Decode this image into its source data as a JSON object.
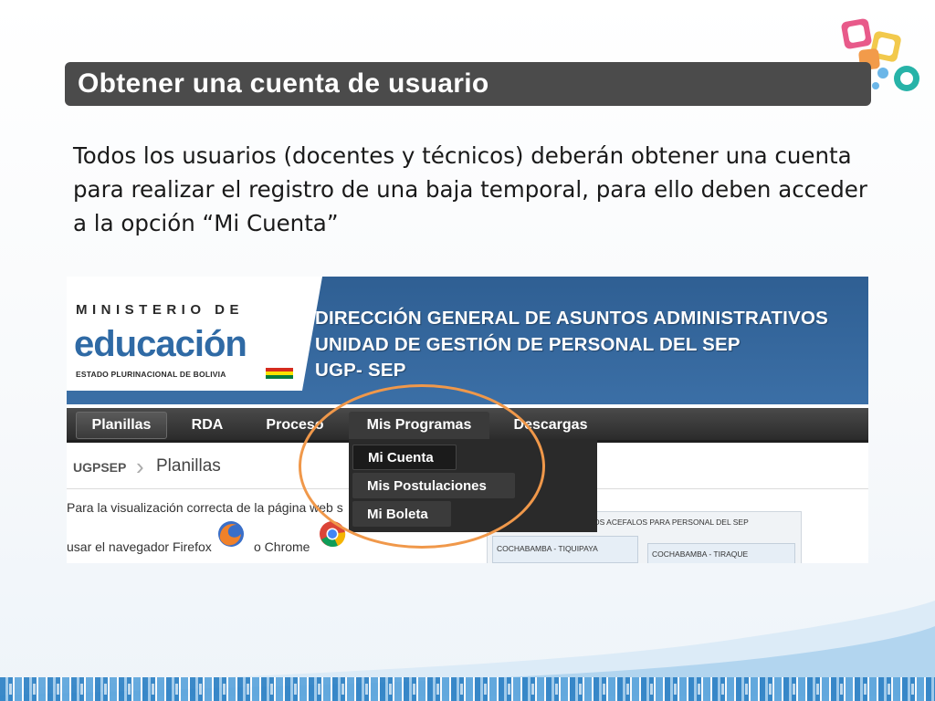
{
  "slide": {
    "title": "Obtener una cuenta de usuario",
    "paragraph": "Todos los usuarios (docentes y técnicos) deberán obtener una cuenta para realizar el registro de una baja temporal, para ello deben acceder a la opción “Mi Cuenta”"
  },
  "web": {
    "ministry": {
      "line1": "MINISTERIO DE",
      "line2": "educación",
      "line3": "ESTADO PLURINACIONAL DE BOLIVIA"
    },
    "header": {
      "line1": "DIRECCIÓN GENERAL DE ASUNTOS ADMINISTRATIVOS",
      "line2": "UNIDAD DE GESTIÓN DE PERSONAL DEL SEP",
      "line3": "UGP- SEP"
    },
    "nav": [
      {
        "label": "Planillas"
      },
      {
        "label": "RDA"
      },
      {
        "label": "Proceso"
      },
      {
        "label": "Mis Programas"
      },
      {
        "label": "Descargas"
      }
    ],
    "dropdown": [
      {
        "label": "Mi Cuenta"
      },
      {
        "label": "Mis Postulaciones"
      },
      {
        "label": "Mi Boleta"
      }
    ],
    "breadcrumb": {
      "home": "UGPSEP",
      "current": "Planillas"
    },
    "notice": {
      "line1": "Para la visualización correcta de la página web s",
      "line2a": "usar el navegador Firefox",
      "line2b": "o Chrome"
    },
    "panel": {
      "header": "OS ACEFALOS PARA PERSONAL DEL SEP",
      "cell_a": "COCHABAMBA - TIQUIPAYA",
      "cell_b": "COCHABAMBA - TIRAQUE"
    }
  },
  "icons": {
    "firefox": "firefox-icon",
    "chrome": "chrome-icon",
    "logo": "ministry-logo-icon"
  },
  "colors": {
    "title_bar": "#4b4b4b",
    "header_blue": "#3b6fa6",
    "nav_dark": "#2b2b2b",
    "highlight_orange": "#f0984a"
  }
}
